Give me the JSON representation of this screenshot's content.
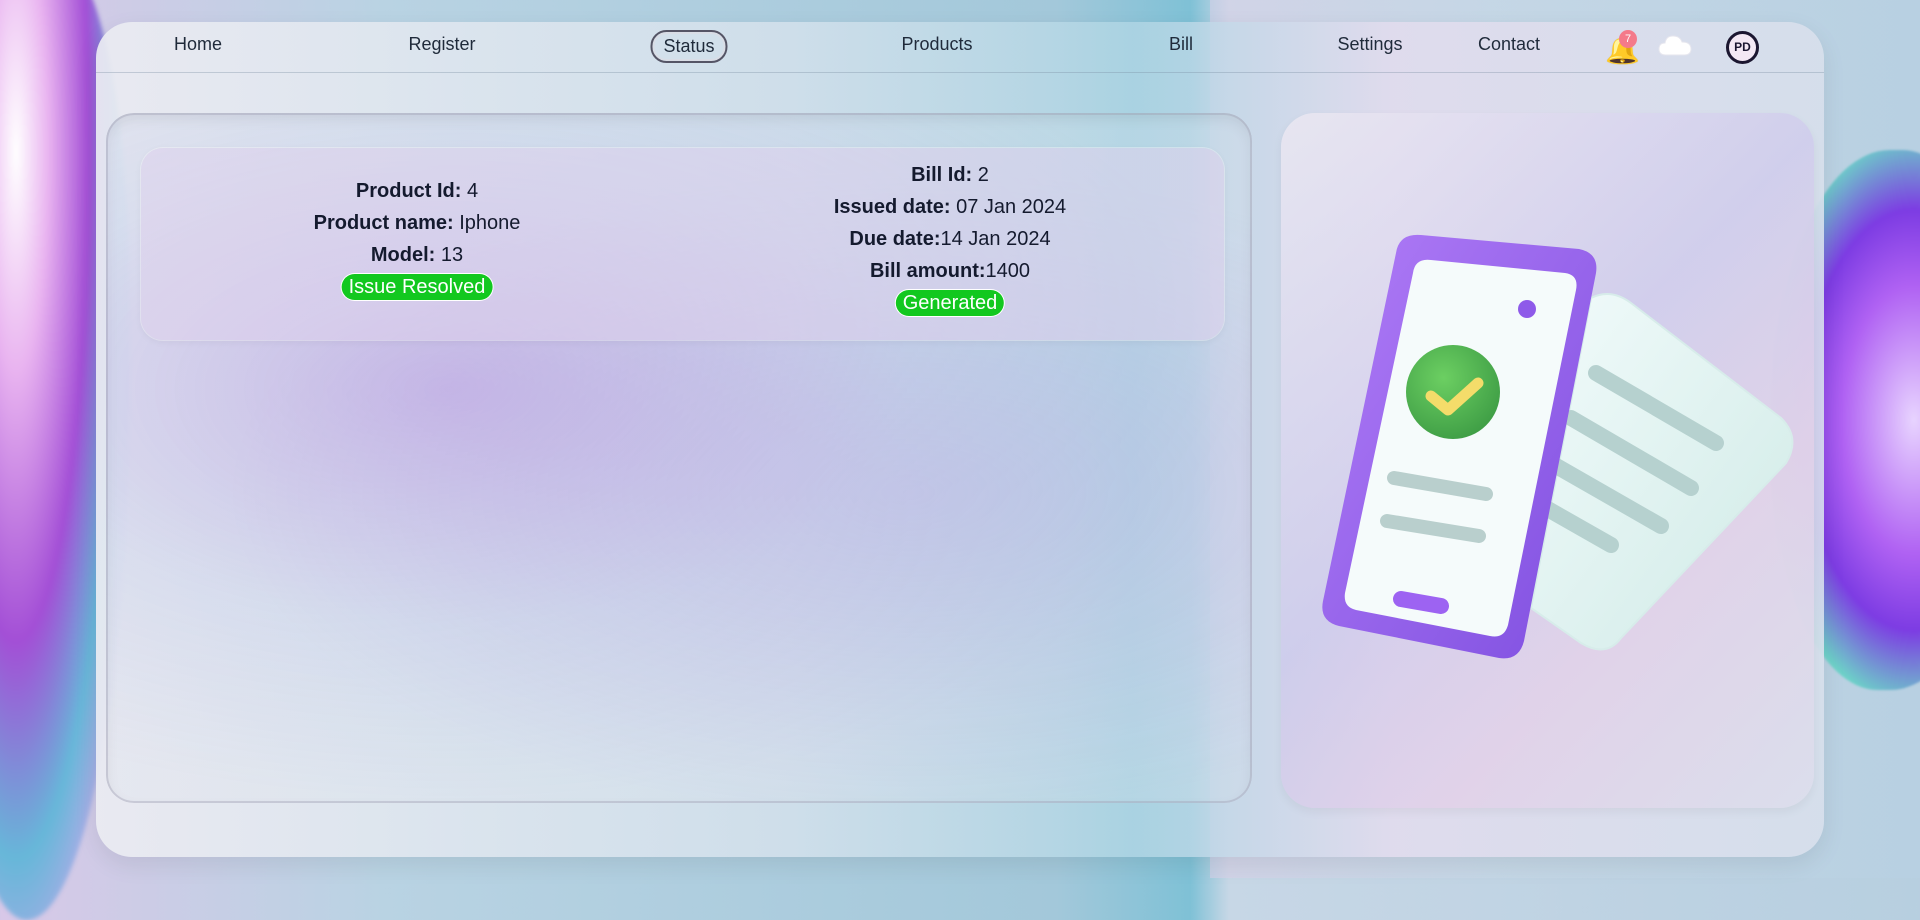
{
  "nav": {
    "items": [
      {
        "label": "Home"
      },
      {
        "label": "Register"
      },
      {
        "label": "Status",
        "active": true
      },
      {
        "label": "Products"
      },
      {
        "label": "Bill"
      },
      {
        "label": "Settings"
      },
      {
        "label": "Contact"
      }
    ],
    "notifications": {
      "count": "7",
      "icon": "bell-icon"
    },
    "cloud_icon": "cloud-icon",
    "avatar_initials": "PD"
  },
  "product": {
    "id_label": "Product Id:",
    "id_value": "4",
    "name_label": "Product name:",
    "name_value": "Iphone",
    "model_label": "Model:",
    "model_value": "13",
    "status": "Issue Resolved"
  },
  "bill": {
    "id_label": "Bill Id:",
    "id_value": "2",
    "issued_label": "Issued date:",
    "issued_value": "07 Jan 2024",
    "due_label": "Due date:",
    "due_value": "14 Jan 2024",
    "amount_label": "Bill amount:",
    "amount_value": "1400",
    "status": "Generated"
  },
  "colors": {
    "badge_green": "#12c81f",
    "notification_red": "#f47a8a",
    "phone_purple": "#9b5cf1",
    "check_green": "#4bb54f"
  },
  "illustration": {
    "icon": "phone-bill-checkmark-illustration"
  }
}
